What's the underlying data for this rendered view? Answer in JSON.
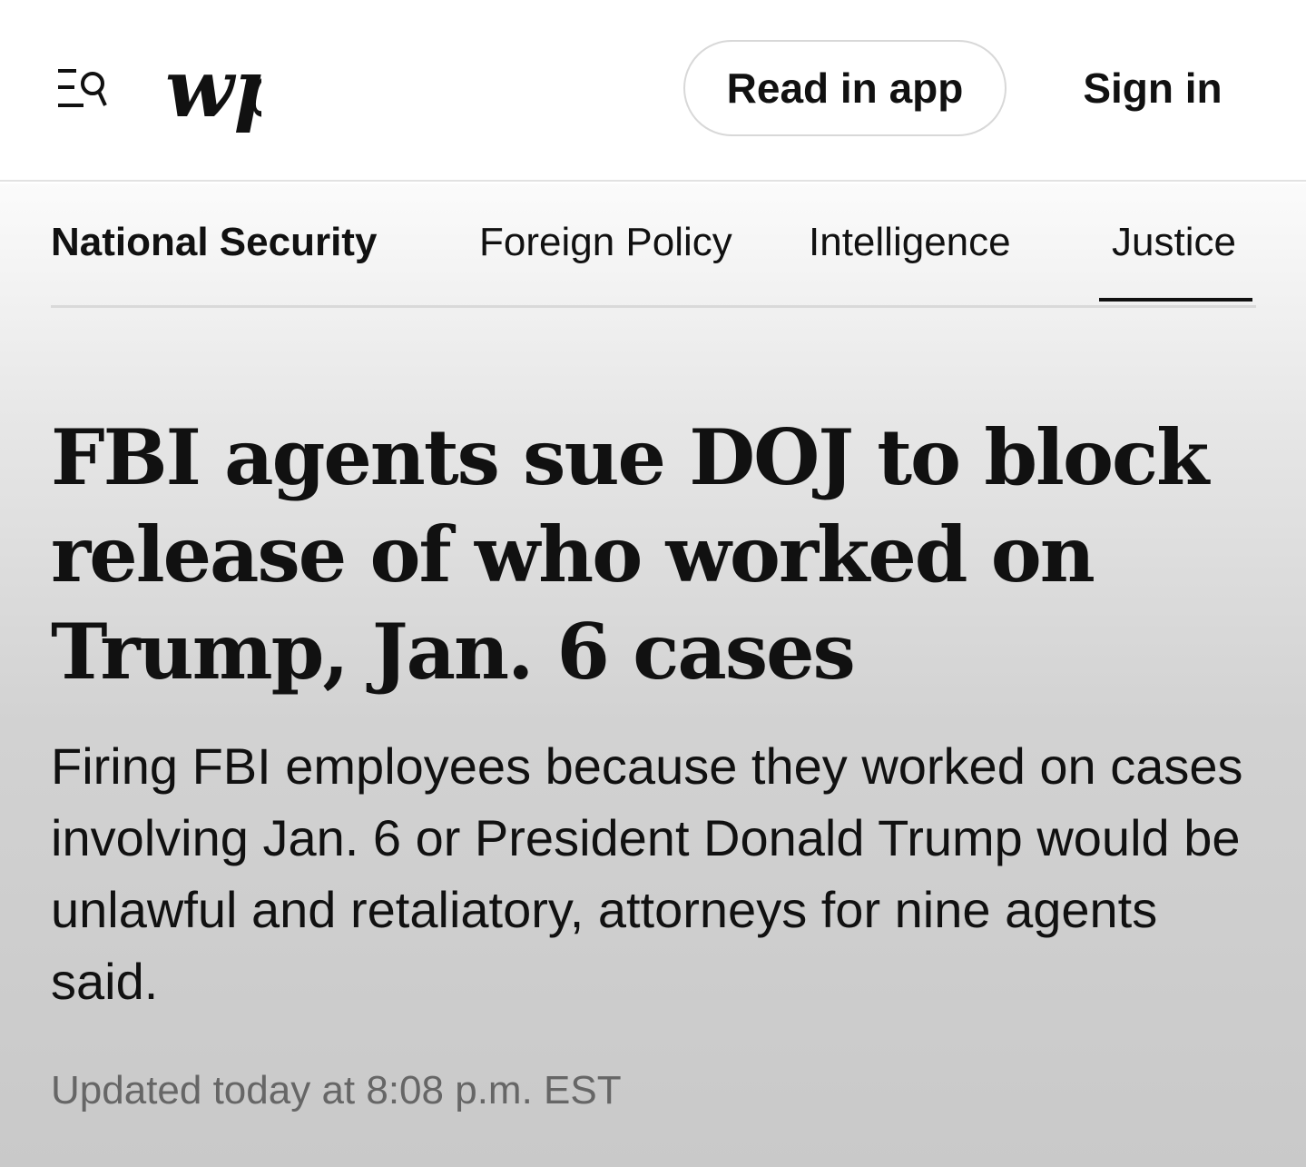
{
  "header": {
    "menu_icon": "menu-search-icon",
    "logo_text": "wp",
    "read_in_app": "Read in app",
    "sign_in": "Sign in"
  },
  "subnav": {
    "section_title": "National Security",
    "items": [
      {
        "label": "Foreign Policy"
      },
      {
        "label": "Intelligence"
      },
      {
        "label": "Justice",
        "active": true
      }
    ]
  },
  "article": {
    "headline": "FBI agents sue DOJ to block release of who worked on Trump, Jan. 6 cases",
    "dek": "Firing FBI employees because they worked on cases involving Jan. 6 or President Donald Trump would be unlawful and retaliatory, attorneys for nine agents said.",
    "timestamp": "Updated today at 8:08 p.m. EST"
  },
  "colors": {
    "text": "#111111",
    "timestamp": "#666666",
    "divider": "#d9d9d9"
  }
}
